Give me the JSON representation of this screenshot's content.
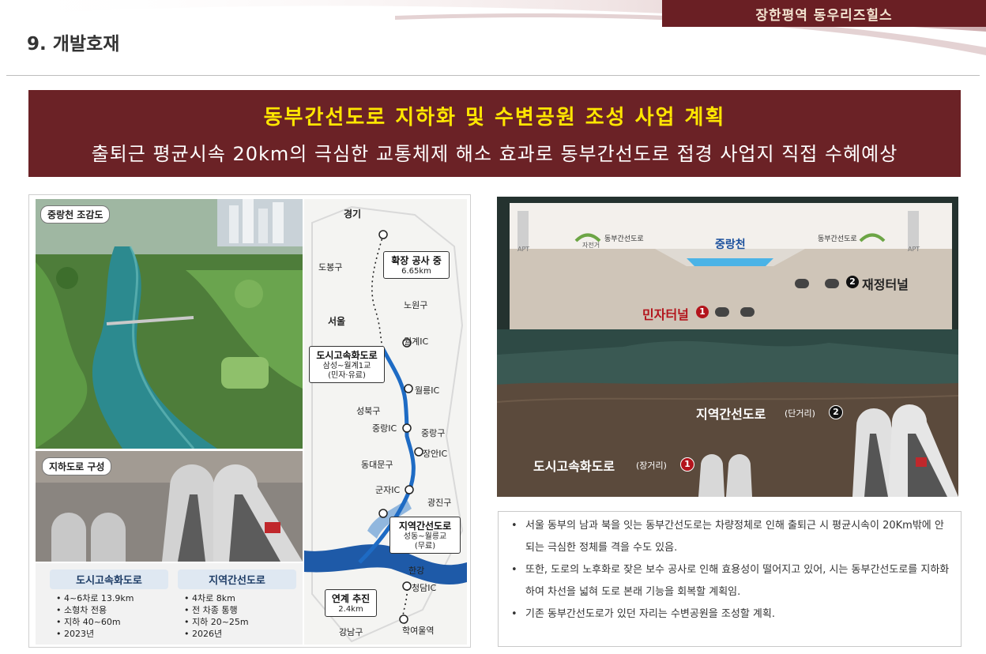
{
  "header": {
    "brand": "장한평역 동우리즈힐스",
    "section_title": "9. 개발호재"
  },
  "headline": {
    "line1": "동부간선도로 지하화 및 수변공원 조성 사업 계획",
    "line2": "출퇴근 평균시속 20km의 극심한 교통체제 해소 효과로 동부간선도로 접경 사업지 직접 수혜예상"
  },
  "left_panel": {
    "tag_aerial": "중랑천 조감도",
    "tag_tunnel": "지하도로 구성",
    "spec_urban": {
      "title": "도시고속화도로",
      "items": [
        "• 4~6차로 13.9km",
        "• 소형차 전용",
        "• 지하 40~60m",
        "• 2023년"
      ]
    },
    "spec_regional": {
      "title": "지역간선도로",
      "items": [
        "• 4차로 8km",
        "• 전 차종 통행",
        "• 지하 20~25m",
        "• 2026년"
      ]
    },
    "map": {
      "labels": {
        "gyeonggi": "경기",
        "dobong": "도봉구",
        "nowon": "노원구",
        "seoul": "서울",
        "wolgye": "월계IC",
        "wolleung": "월릉IC",
        "seongbuk": "성북구",
        "jungnang_ic": "중랑IC",
        "jungnang_gu": "중랑구",
        "jangan": "장안IC",
        "dongdaemun": "동대문구",
        "gunja": "군자IC",
        "gwangjin": "광진구",
        "hangang": "한강",
        "cheongdam": "청담IC",
        "gangnam": "강남구",
        "hakyeoul": "학여울역"
      },
      "box_expand": {
        "title": "확장 공사 중",
        "sub": "6.65km"
      },
      "box_urban": {
        "title": "도시고속화도로",
        "sub1": "삼성~월계1교",
        "sub2": "(민자·유료)"
      },
      "box_regional": {
        "title": "지역간선도로",
        "sub1": "성동~월릉교",
        "sub2": "(무료)"
      },
      "box_link": {
        "title": "연계 추진",
        "sub": "2.4km"
      }
    }
  },
  "section_panel": {
    "apt_left": "APT",
    "apt_right": "APT",
    "bike_path": "자전거",
    "road_left": "동부간선도로",
    "road_right": "동부간선도로",
    "stream": "중랑천",
    "reorg_tunnel_num": "2",
    "reorg_tunnel": "재정터널",
    "private_tunnel": "민자터널",
    "private_tunnel_num": "1",
    "regional_road": "지역간선도로",
    "regional_road_note": "(단거리)",
    "regional_road_num": "2",
    "urban_road": "도시고속화도로",
    "urban_road_note": "(장거리)",
    "urban_road_num": "1"
  },
  "notes": [
    "서울 동부의 남과 북을 잇는 동부간선도로는 차량정체로 인해 출퇴근 시 평균시속이 20Km밖에 안되는 극심한 정체를 격을 수도 있음.",
    "또한, 도로의 노후화로 잦은 보수 공사로 인해 효용성이 떨어지고 있어, 시는 동부간선도로를 지하화 하여 차선을 넓혀 도로 본래 기능을 회복할 계획임.",
    "기존 동부간선도로가 있던 자리는 수변공원을 조성할 계획."
  ]
}
